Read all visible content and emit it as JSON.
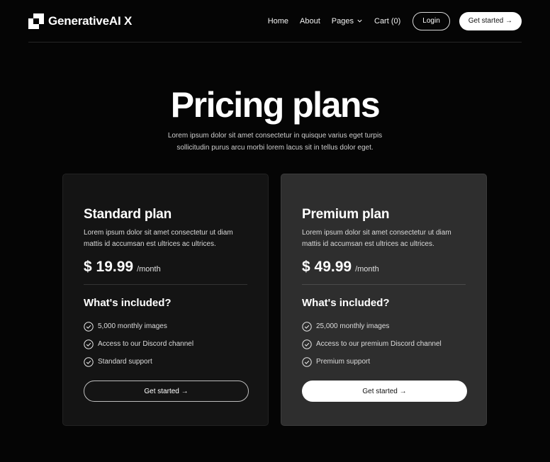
{
  "brand": {
    "name": "GenerativeAI X",
    "logo_icon": "stepped-square-logo-icon"
  },
  "nav": {
    "links": [
      "Home",
      "About",
      "Pages",
      "Cart (0)"
    ],
    "login_label": "Login",
    "cta_label": "Get started →"
  },
  "hero": {
    "title": "Pricing plans",
    "subtitle_line1": "Lorem ipsum dolor sit amet consectetur in quisque varius eget turpis",
    "subtitle_line2": "sollicitudin purus arcu morbi lorem lacus sit in tellus dolor eget."
  },
  "plans": [
    {
      "name": "Standard plan",
      "description": "Lorem ipsum dolor sit amet consectetur ut diam mattis id accumsan est ultrices ac ultrices.",
      "price": "$ 19.99",
      "period": "/month",
      "included_heading": "What's included?",
      "features": [
        "5,000 monthly images",
        "Access to our Discord channel",
        "Standard support"
      ],
      "button_label": "Get started →"
    },
    {
      "name": "Premium plan",
      "description": "Lorem ipsum dolor sit amet consectetur ut diam mattis id accumsan est ultrices ac ultrices.",
      "price": "$ 49.99",
      "period": "/month",
      "included_heading": "What's included?",
      "features": [
        "25,000 monthly images",
        "Access to our premium Discord channel",
        "Premium support"
      ],
      "button_label": "Get started →"
    }
  ],
  "colors": {
    "background": "#050505",
    "standard_card": "#141414",
    "premium_card": "#2e2e2e",
    "text": "#ffffff"
  }
}
